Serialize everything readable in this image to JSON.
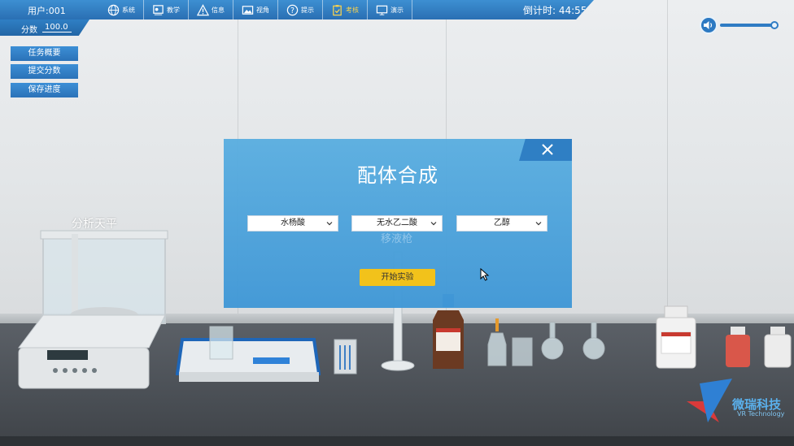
{
  "header": {
    "user": "用户:001",
    "menu": [
      {
        "icon": "globe-icon",
        "label": "系统",
        "active": false
      },
      {
        "icon": "teach-icon",
        "label": "教学",
        "active": false
      },
      {
        "icon": "warning-icon",
        "label": "信息",
        "active": false
      },
      {
        "icon": "image-icon",
        "label": "视角",
        "active": false
      },
      {
        "icon": "help-icon",
        "label": "提示",
        "active": false
      },
      {
        "icon": "clipboard-icon",
        "label": "考核",
        "active": true
      },
      {
        "icon": "monitor-icon",
        "label": "演示",
        "active": false
      }
    ],
    "timer": "倒计时: 44:55"
  },
  "score": {
    "label": "分数",
    "value": "100.0"
  },
  "side_buttons": [
    "任务概要",
    "提交分数",
    "保存进度"
  ],
  "volume": {
    "level": 0.95
  },
  "modal": {
    "title": "配体合成",
    "selects": [
      "水杨酸",
      "无水乙二酸",
      "乙醇"
    ],
    "start_button": "开始实验",
    "background_label": "移液枪"
  },
  "scene": {
    "balance_label": "分析天平"
  },
  "logo": {
    "name": "微瑞科技",
    "subtitle": "VR Technology"
  },
  "colors": {
    "accent": "#2f7fc4",
    "active": "#ffd54a",
    "button": "#f2c21b"
  }
}
